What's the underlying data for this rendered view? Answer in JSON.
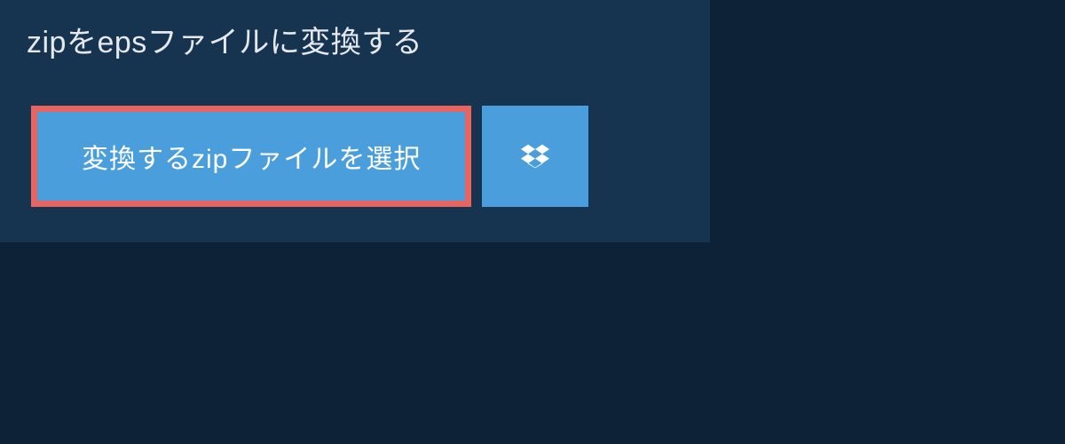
{
  "header": {
    "title": "zipをepsファイルに変換する"
  },
  "buttons": {
    "select_file_label": "変換するzipファイルを選択"
  },
  "colors": {
    "background": "#0d2237",
    "panel": "#163350",
    "button": "#4a9edb",
    "button_border": "#e86460",
    "text": "#e5e8ec"
  }
}
